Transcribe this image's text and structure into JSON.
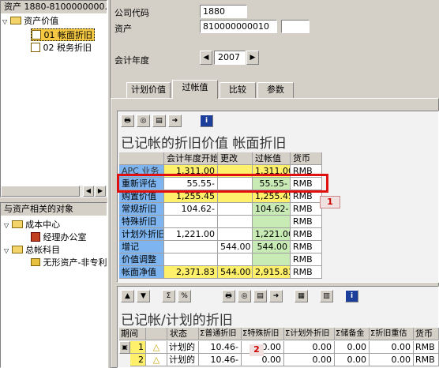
{
  "tree": {
    "title": "资产 1880-8100000000...",
    "root": "资产价值",
    "item1": "01  帐面折旧",
    "item2": "02  税务折旧"
  },
  "related": {
    "title": "与资产相关的对象",
    "cost_center": "成本中心",
    "cost_center_val": "经理办公室",
    "gl": "总帐科目",
    "gl_val": "无形资产-非专利"
  },
  "header": {
    "company_label": "公司代码",
    "company_value": "1880",
    "asset_label": "资产",
    "asset_value": "810000000010",
    "fy_label": "会计年度",
    "fy_value": "2007"
  },
  "tabs": [
    "计划价值",
    "过帐值",
    "比较",
    "参数"
  ],
  "table1": {
    "title": "已记帐的折旧价值 帐面折旧",
    "headers": [
      "",
      "会计年度开始",
      "更改",
      "过帐值",
      "货币"
    ],
    "rows": [
      {
        "label": "APC 业务",
        "start": "1,311.00",
        "change": "",
        "posted": "1,311.00",
        "cur": "RMB"
      },
      {
        "label": "重新评估",
        "start": "55.55-",
        "change": "",
        "posted": "55.55-",
        "cur": "RMB"
      },
      {
        "label": "购置价值",
        "start": "1,255.45",
        "change": "",
        "posted": "1,255.45",
        "cur": "RMB"
      },
      {
        "label": "常规折旧",
        "start": "104.62-",
        "change": "",
        "posted": "104.62-",
        "cur": "RMB"
      },
      {
        "label": "特殊折旧",
        "start": "",
        "change": "",
        "posted": "",
        "cur": "RMB"
      },
      {
        "label": "计划外折旧",
        "start": "1,221.00",
        "change": "",
        "posted": "1,221.00",
        "cur": "RMB"
      },
      {
        "label": "增记",
        "start": "",
        "change": "544.00",
        "posted": "544.00",
        "cur": "RMB"
      },
      {
        "label": "价值调整",
        "start": "",
        "change": "",
        "posted": "",
        "cur": "RMB"
      },
      {
        "label": "帐面净值",
        "start": "2,371.83",
        "change": "544.00",
        "posted": "2,915.83",
        "cur": "RMB"
      }
    ],
    "callout": "1"
  },
  "table2": {
    "title": "已记帐/计划的折旧",
    "headers": [
      "期间",
      "",
      "状态",
      "Σ普通折旧",
      "Σ特殊折旧",
      "Σ计划外折旧",
      "Σ储备金",
      "Σ折旧重估",
      "货币"
    ],
    "rows": [
      {
        "period": "1",
        "status": "计划的",
        "ord": "10.46-",
        "spec": "0.00",
        "unpl": "0.00",
        "res": "0.00",
        "reval": "0.00",
        "cur": "RMB"
      },
      {
        "period": "2",
        "status": "计划的",
        "ord": "10.46-",
        "spec": "0.00",
        "unpl": "0.00",
        "res": "0.00",
        "reval": "0.00",
        "cur": "RMB"
      }
    ],
    "callout": "2"
  }
}
